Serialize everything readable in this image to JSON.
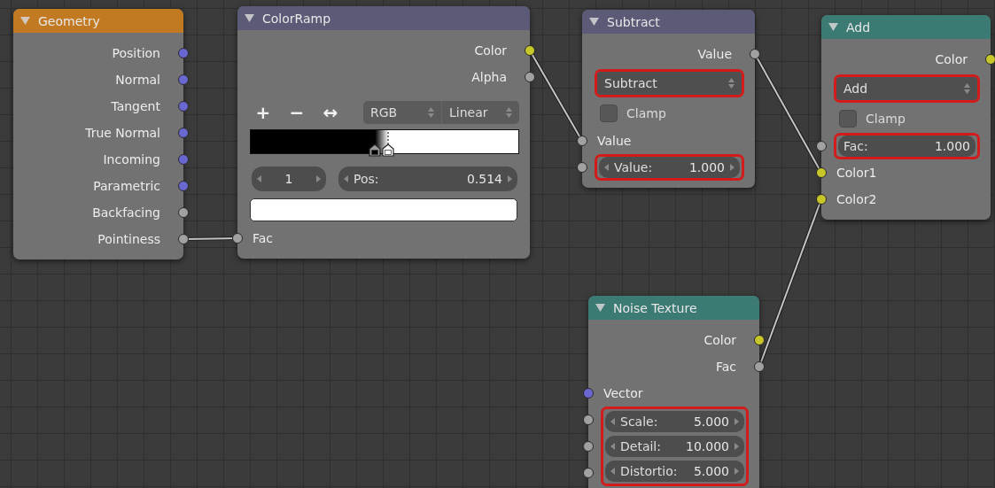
{
  "nodes": [
    {
      "title": "Geometry",
      "color": "#c27a22",
      "rows": [
        {
          "kind": "output",
          "label": "Position",
          "color": "#6868d0"
        },
        {
          "kind": "output",
          "label": "Normal",
          "color": "#6868d0"
        },
        {
          "kind": "output",
          "label": "Tangent",
          "color": "#6868d0"
        },
        {
          "kind": "output",
          "label": "True Normal",
          "color": "#6868d0"
        },
        {
          "kind": "output",
          "label": "Incoming",
          "color": "#6868d0"
        },
        {
          "kind": "output",
          "label": "Parametric",
          "color": "#6868d0"
        },
        {
          "kind": "output",
          "label": "Backfacing",
          "color": "#a1a1a1"
        },
        {
          "kind": "output",
          "label": "Pointiness",
          "color": "#a1a1a1"
        }
      ]
    },
    {
      "title": "ColorRamp",
      "color": "#5b5b78",
      "rows": [
        {
          "kind": "output",
          "label": "Color",
          "color": "#c7c729"
        },
        {
          "kind": "output",
          "label": "Alpha",
          "color": "#a1a1a1"
        },
        {
          "kind": "ramp_tools",
          "add": "+",
          "remove": "−",
          "flip": "↔",
          "color_mode": "RGB",
          "interpolation": "Linear"
        },
        {
          "kind": "ramp",
          "stops": [
            {
              "level": 0.465,
              "color": "#000000",
              "selected": false
            },
            {
              "level": 0.514,
              "color": "#ffffff",
              "selected": true
            }
          ]
        },
        {
          "kind": "stop_fields",
          "index": "1",
          "pos_label": "Pos:",
          "pos_value": "0.514"
        },
        {
          "kind": "swatch",
          "color": "#ffffff"
        },
        {
          "kind": "input",
          "label": "Fac",
          "color": "#a1a1a1"
        }
      ]
    },
    {
      "title": "Subtract",
      "color": "#5b5b78",
      "rows": [
        {
          "kind": "output",
          "label": "Value",
          "color": "#a1a1a1"
        },
        {
          "kind": "menu",
          "value": "Subtract",
          "highlighted": true
        },
        {
          "kind": "checkbox",
          "label": "Clamp",
          "checked": false
        },
        {
          "kind": "input",
          "label": "Value",
          "color": "#a1a1a1"
        },
        {
          "kind": "fields",
          "highlighted": true,
          "items": [
            {
              "label": "Value:",
              "value": "1.000",
              "color": "#a1a1a1",
              "arrows": true
            }
          ]
        }
      ]
    },
    {
      "title": "Add",
      "color": "#3c7a74",
      "rows": [
        {
          "kind": "output",
          "label": "Color",
          "color": "#c7c729"
        },
        {
          "kind": "menu",
          "value": "Add",
          "highlighted": true
        },
        {
          "kind": "checkbox",
          "label": "Clamp",
          "checked": false
        },
        {
          "kind": "fields",
          "highlighted": true,
          "items": [
            {
              "label": "Fac:",
              "value": "1.000",
              "color": "#a1a1a1",
              "arrows": false
            }
          ]
        },
        {
          "kind": "input",
          "label": "Color1",
          "color": "#c7c729"
        },
        {
          "kind": "input",
          "label": "Color2",
          "color": "#c7c729"
        }
      ]
    },
    {
      "title": "Noise Texture",
      "color": "#3c7a74",
      "rows": [
        {
          "kind": "output",
          "label": "Color",
          "color": "#c7c729"
        },
        {
          "kind": "output",
          "label": "Fac",
          "color": "#a1a1a1"
        },
        {
          "kind": "input",
          "label": "Vector",
          "color": "#6868d0"
        },
        {
          "kind": "fields",
          "highlighted": true,
          "items": [
            {
              "label": "Scale:",
              "value": "5.000",
              "color": "#a1a1a1",
              "arrows": true
            },
            {
              "label": "Detail:",
              "value": "10.000",
              "color": "#a1a1a1",
              "arrows": true
            },
            {
              "label": "Distortio:",
              "value": "5.000",
              "color": "#a1a1a1",
              "arrows": true
            }
          ]
        }
      ]
    }
  ]
}
